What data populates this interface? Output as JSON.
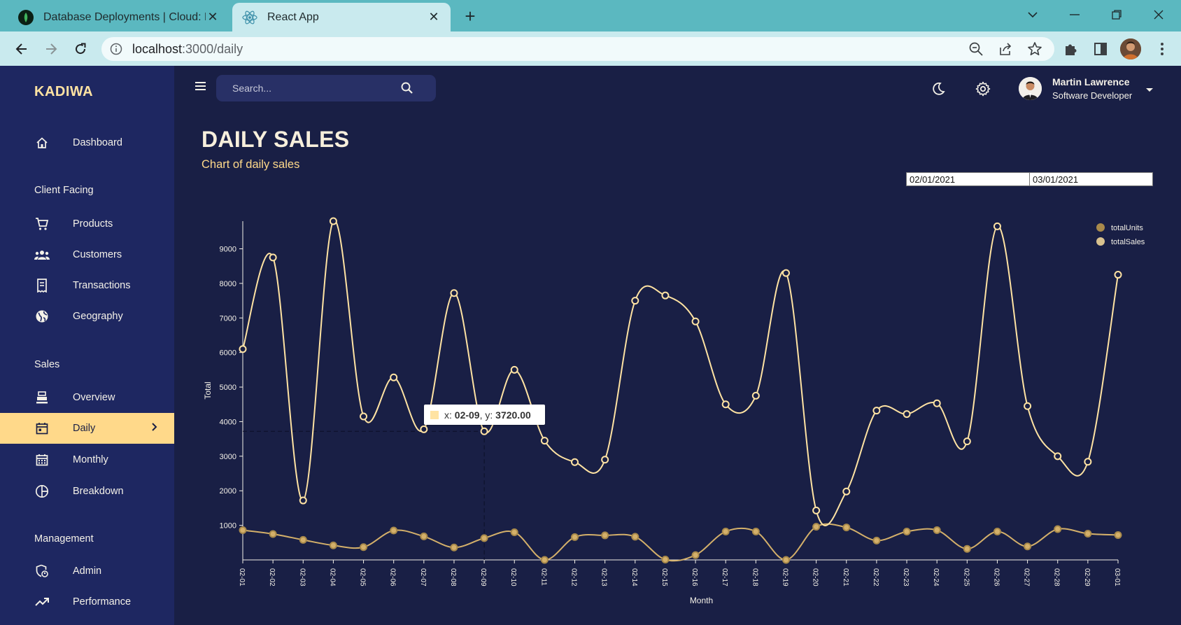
{
  "browser": {
    "tabs": [
      {
        "title": "Database Deployments | Cloud: M",
        "active": false
      },
      {
        "title": "React App",
        "active": true
      }
    ],
    "url_host": "localhost",
    "url_path": ":3000/daily"
  },
  "app": {
    "brand": "KADIWA",
    "search_placeholder": "Search...",
    "user": {
      "name": "Martin Lawrence",
      "role": "Software Developer"
    },
    "sidebar": {
      "items": [
        {
          "label": "Dashboard",
          "icon": "home-icon"
        },
        {
          "section": "Client Facing"
        },
        {
          "label": "Products",
          "icon": "cart-icon"
        },
        {
          "label": "Customers",
          "icon": "groups-icon"
        },
        {
          "label": "Transactions",
          "icon": "receipt-icon"
        },
        {
          "label": "Geography",
          "icon": "globe-icon"
        },
        {
          "section": "Sales"
        },
        {
          "label": "Overview",
          "icon": "point-of-sale-icon"
        },
        {
          "label": "Daily",
          "icon": "calendar-today-icon",
          "active": true
        },
        {
          "label": "Monthly",
          "icon": "calendar-month-icon"
        },
        {
          "label": "Breakdown",
          "icon": "pie-chart-icon"
        },
        {
          "section": "Management"
        },
        {
          "label": "Admin",
          "icon": "admin-icon"
        },
        {
          "label": "Performance",
          "icon": "trending-up-icon"
        }
      ]
    },
    "page": {
      "title": "DAILY SALES",
      "subtitle": "Chart of daily sales",
      "start_date": "02/01/2021",
      "end_date": "03/01/2021"
    },
    "tooltip": {
      "x_label": "x: ",
      "x_value": "02-09",
      "y_label": ", y: ",
      "y_value": "3720.00"
    },
    "colors": {
      "totalSales": "#ffe3a3",
      "totalUnits": "#d4b06a",
      "background": "#191f45",
      "sidebar": "#1e2761",
      "accent": "#ffd98a"
    }
  },
  "chart_data": {
    "type": "line",
    "xlabel": "Month",
    "ylabel": "Total",
    "ylim": [
      0,
      9800
    ],
    "yticks": [
      1000,
      2000,
      3000,
      4000,
      5000,
      6000,
      7000,
      8000,
      9000
    ],
    "categories": [
      "02-01",
      "02-02",
      "02-03",
      "02-04",
      "02-05",
      "02-06",
      "02-07",
      "02-08",
      "02-09",
      "02-10",
      "02-11",
      "02-12",
      "02-13",
      "02-14",
      "02-15",
      "02-16",
      "02-17",
      "02-18",
      "02-19",
      "02-20",
      "02-21",
      "02-22",
      "02-23",
      "02-24",
      "02-25",
      "02-26",
      "02-27",
      "02-28",
      "02-29",
      "03-01"
    ],
    "legend_position": "top-right",
    "series": [
      {
        "name": "totalUnits",
        "values": [
          860,
          750,
          580,
          420,
          370,
          850,
          680,
          360,
          630,
          800,
          0,
          660,
          710,
          670,
          10,
          140,
          820,
          820,
          0,
          960,
          940,
          560,
          820,
          860,
          320,
          820,
          390,
          890,
          760,
          720
        ]
      },
      {
        "name": "totalSales",
        "values": [
          6100,
          8750,
          1720,
          9800,
          4150,
          5280,
          3780,
          7720,
          3720,
          5500,
          3450,
          2830,
          2900,
          7500,
          7650,
          6900,
          4500,
          4750,
          8300,
          1430,
          1980,
          4320,
          4220,
          4530,
          3430,
          9650,
          4450,
          3000,
          2840,
          8250
        ]
      }
    ]
  }
}
